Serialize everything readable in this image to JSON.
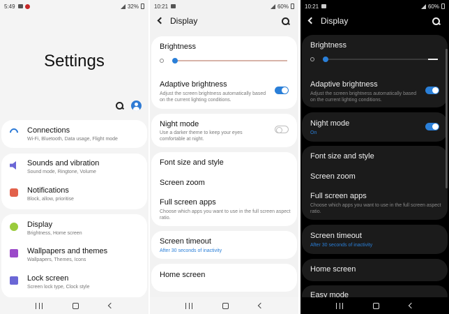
{
  "panel1": {
    "status": {
      "time": "5:49",
      "battery": "32%"
    },
    "title": "Settings",
    "items": [
      {
        "title": "Connections",
        "subtitle": "Wi-Fi, Bluetooth, Data usage, Flight mode",
        "icon": "wifi-icon",
        "color": "#2a78d6"
      },
      {
        "title": "Sounds and vibration",
        "subtitle": "Sound mode, Ringtone, Volume",
        "icon": "volume-icon",
        "color": "#6b67d6"
      },
      {
        "title": "Notifications",
        "subtitle": "Block, allow, prioritise",
        "icon": "notification-icon",
        "color": "#e2614b"
      },
      {
        "title": "Display",
        "subtitle": "Brightness, Home screen",
        "icon": "display-icon",
        "color": "#9acb3c"
      },
      {
        "title": "Wallpapers and themes",
        "subtitle": "Wallpapers, Themes, Icons",
        "icon": "brush-icon",
        "color": "#9b4ac9"
      },
      {
        "title": "Lock screen",
        "subtitle": "Screen lock type, Clock style",
        "icon": "lock-icon",
        "color": "#6b67d6"
      }
    ]
  },
  "panel2": {
    "status": {
      "time": "10:21",
      "battery": "60%"
    },
    "header": "Display",
    "brightness": {
      "label": "Brightness",
      "level": 0
    },
    "adaptive": {
      "title": "Adaptive brightness",
      "subtitle": "Adjust the screen brightness automatically based on the current lighting conditions.",
      "on": true
    },
    "night": {
      "title": "Night mode",
      "subtitle": "Use a darker theme to keep your eyes comfortable at night.",
      "on": false
    },
    "font": "Font size and style",
    "zoom": "Screen zoom",
    "fullscreen": {
      "title": "Full screen apps",
      "subtitle": "Choose which apps you want to use in the full screen aspect ratio."
    },
    "timeout": {
      "title": "Screen timeout",
      "value": "After 30 seconds of inactivity"
    },
    "home": "Home screen"
  },
  "panel3": {
    "status": {
      "time": "10:21",
      "battery": "60%"
    },
    "header": "Display",
    "brightness": {
      "label": "Brightness",
      "level": 0
    },
    "adaptive": {
      "title": "Adaptive brightness",
      "subtitle": "Adjust the screen brightness automatically based on the current lighting conditions.",
      "on": true
    },
    "night": {
      "title": "Night mode",
      "value": "On",
      "on": true
    },
    "font": "Font size and style",
    "zoom": "Screen zoom",
    "fullscreen": {
      "title": "Full screen apps",
      "subtitle": "Choose which apps you want to use in the full screen aspect ratio."
    },
    "timeout": {
      "title": "Screen timeout",
      "value": "After 30 seconds of inactivity"
    },
    "home": "Home screen",
    "easy": "Easy mode"
  },
  "colors": {
    "accent": "#2a7fd8",
    "dark_bg": "#000000",
    "light_bg": "#f4f4f4"
  }
}
